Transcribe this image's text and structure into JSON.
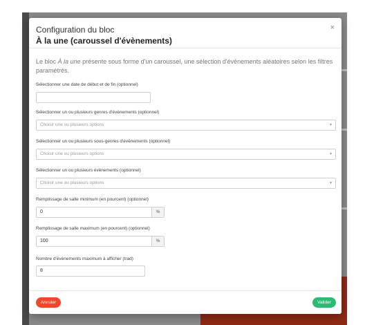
{
  "modal": {
    "title_top": "Configuration du bloc",
    "title_main": "À la une (caroussel d'évènements)",
    "close_glyph": "×",
    "description": {
      "prefix": "Le bloc ",
      "emphasis": "À la une",
      "suffix": " présente sous forme d'un caroussel, une sélection d'évènements aléatoires selon les filtres paramétrés."
    }
  },
  "form": {
    "dates": {
      "label": "Sélectionner une date de début et de fin (optionnel)",
      "value": ""
    },
    "genres": {
      "label": "Sélectionner un ou plusieurs genres d'évènements (optionnel)",
      "placeholder": "Choisir une ou plusieurs options"
    },
    "subgenres": {
      "label": "Sélectionner un ou plusieurs sous-genres d'évènements (optionnel)",
      "placeholder": "Choisir une ou plusieurs options"
    },
    "events": {
      "label": "Sélectionner un ou plusieurs évènements (optionnel)",
      "placeholder": "Choisir une ou plusieurs options"
    },
    "min_fill": {
      "label": "Remplissage de salle minimum (en pourcent) (optionnel)",
      "value": "0",
      "suffix": "%"
    },
    "max_fill": {
      "label": "Remplissage de salle maximum (en pourcent) (optionnel)",
      "value": "100",
      "suffix": "%"
    },
    "max_events": {
      "label": "Nombre d'évènements maximum à afficher (trad)",
      "value": "8"
    },
    "caret_glyph": "▾"
  },
  "footer": {
    "cancel_label": "Annuler",
    "submit_label": "Valider"
  },
  "colors": {
    "cancel": "#f0462d",
    "submit": "#2dbb73",
    "backdrop_red": "#8e2a16"
  }
}
